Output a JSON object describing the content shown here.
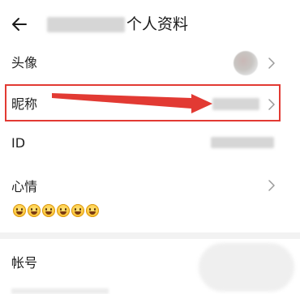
{
  "header": {
    "title": "个人资料",
    "back_icon": "back-arrow-icon"
  },
  "rows": {
    "avatar": {
      "label": "头像"
    },
    "nickname": {
      "label": "昵称"
    },
    "id": {
      "label": "ID"
    },
    "mood": {
      "label": "心情",
      "emoji_count": 6
    },
    "account": {
      "label": "帐号"
    }
  },
  "annotation": {
    "color": "#e23a33"
  }
}
